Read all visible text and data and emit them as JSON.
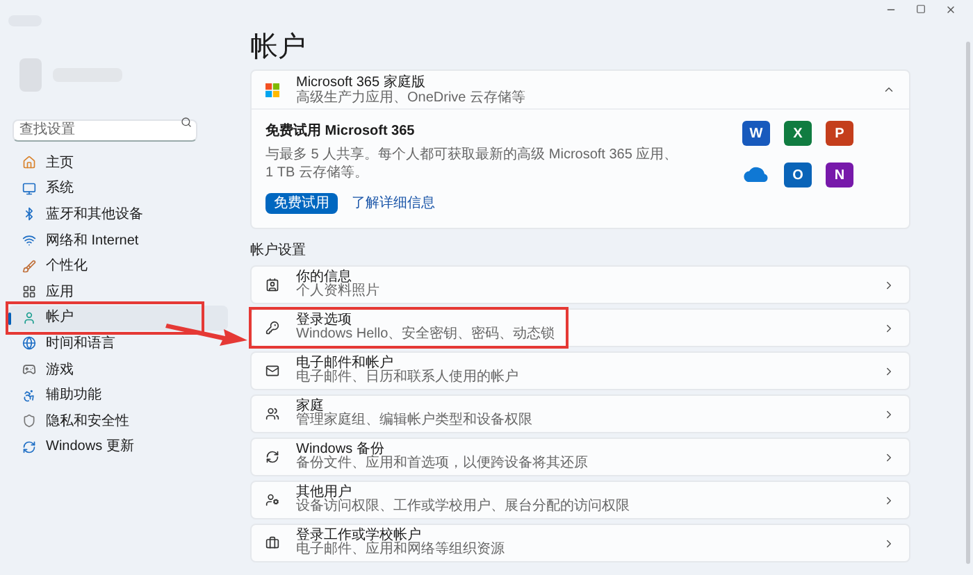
{
  "search": {
    "placeholder": "查找设置"
  },
  "sidebar": {
    "items": [
      {
        "label": "主页",
        "selected": false,
        "highlighted": false
      },
      {
        "label": "系统",
        "selected": false,
        "highlighted": false
      },
      {
        "label": "蓝牙和其他设备",
        "selected": false,
        "highlighted": false
      },
      {
        "label": "网络和 Internet",
        "selected": false,
        "highlighted": false
      },
      {
        "label": "个性化",
        "selected": false,
        "highlighted": false
      },
      {
        "label": "应用",
        "selected": false,
        "highlighted": false
      },
      {
        "label": "帐户",
        "selected": true,
        "highlighted": true
      },
      {
        "label": "时间和语言",
        "selected": false,
        "highlighted": false
      },
      {
        "label": "游戏",
        "selected": false,
        "highlighted": false
      },
      {
        "label": "辅助功能",
        "selected": false,
        "highlighted": false
      },
      {
        "label": "隐私和安全性",
        "selected": false,
        "highlighted": false
      },
      {
        "label": "Windows 更新",
        "selected": false,
        "highlighted": false
      }
    ]
  },
  "page_title": "帐户",
  "m365": {
    "title": "Microsoft 365 家庭版",
    "subtitle": "高级生产力应用、OneDrive 云存储等",
    "expanded": true,
    "offer_title": "免费试用 Microsoft 365",
    "offer_text": "与最多 5 人共享。每个人都可获取最新的高级 Microsoft 365 应用、1 TB 云存储等。",
    "primary_button": "免费试用",
    "link": "了解详细信息",
    "apps": [
      {
        "kind": "letter",
        "letter": "W",
        "color": "#185abd"
      },
      {
        "kind": "letter",
        "letter": "X",
        "color": "#107c41"
      },
      {
        "kind": "letter",
        "letter": "P",
        "color": "#c43e1c"
      },
      {
        "kind": "cloud",
        "color": "#0f78d4"
      },
      {
        "kind": "letter",
        "letter": "O",
        "color": "#0a64b8"
      },
      {
        "kind": "letter",
        "letter": "N",
        "color": "#7719aa"
      }
    ]
  },
  "section_title": "帐户设置",
  "rows": [
    {
      "title": "你的信息",
      "subtitle": "个人资料照片",
      "highlighted": false
    },
    {
      "title": "登录选项",
      "subtitle": "Windows Hello、安全密钥、密码、动态锁",
      "highlighted": true
    },
    {
      "title": "电子邮件和帐户",
      "subtitle": "电子邮件、日历和联系人使用的帐户",
      "highlighted": false
    },
    {
      "title": "家庭",
      "subtitle": "管理家庭组、编辑帐户类型和设备权限",
      "highlighted": false
    },
    {
      "title": "Windows 备份",
      "subtitle": "备份文件、应用和首选项，以便跨设备将其还原",
      "highlighted": false
    },
    {
      "title": "其他用户",
      "subtitle": "设备访问权限、工作或学校用户、展台分配的访问权限",
      "highlighted": false
    },
    {
      "title": "登录工作或学校帐户",
      "subtitle": "电子邮件、应用和网络等组织资源",
      "highlighted": false
    }
  ]
}
